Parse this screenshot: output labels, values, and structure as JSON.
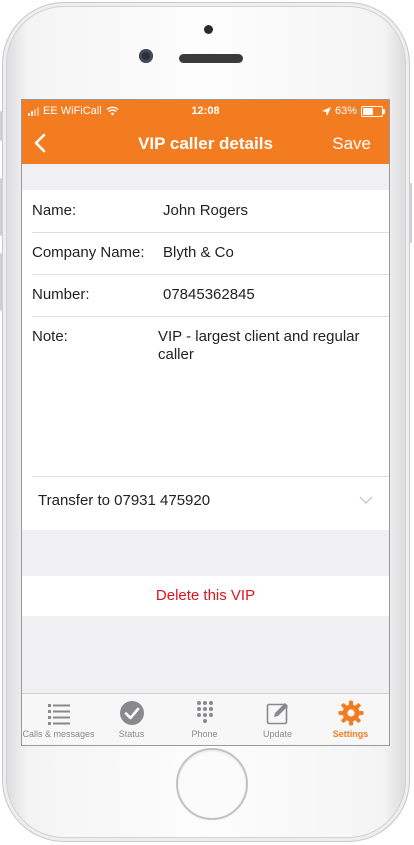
{
  "status_bar": {
    "carrier": "EE WiFiCall",
    "time": "12:08",
    "battery": "63%",
    "battery_level": 0.63
  },
  "nav": {
    "title": "VIP caller details",
    "save_label": "Save"
  },
  "fields": [
    {
      "label": "Name:",
      "value": "John Rogers"
    },
    {
      "label": "Company Name:",
      "value": "Blyth & Co"
    },
    {
      "label": "Number:",
      "value": "07845362845"
    }
  ],
  "note": {
    "label": "Note:",
    "value": "VIP - largest client and regular caller"
  },
  "transfer": {
    "value": "Transfer to 07931 475920"
  },
  "delete_label": "Delete this VIP",
  "tabs": [
    {
      "label": "Calls & messages",
      "icon": "list-icon"
    },
    {
      "label": "Status",
      "icon": "check-circle-icon"
    },
    {
      "label": "Phone",
      "icon": "keypad-icon"
    },
    {
      "label": "Update",
      "icon": "edit-icon"
    },
    {
      "label": "Settings",
      "icon": "gear-icon",
      "active": true
    }
  ],
  "colors": {
    "accent": "#f47c20",
    "destructive": "#e0141c"
  }
}
